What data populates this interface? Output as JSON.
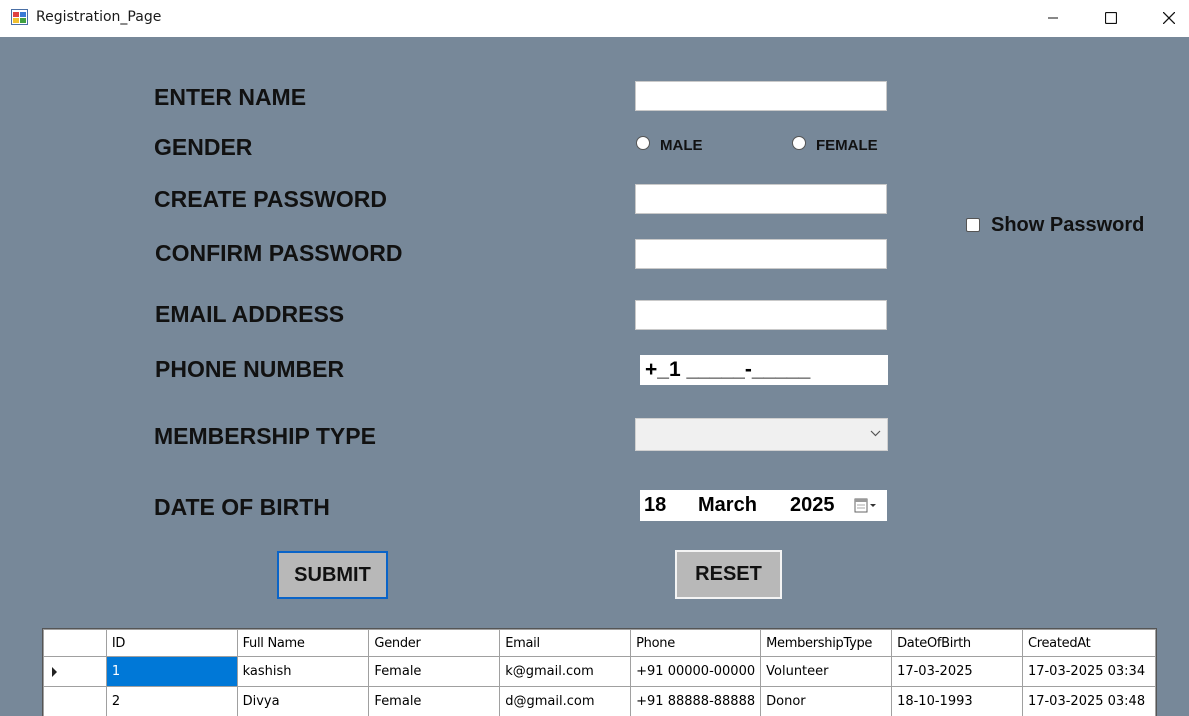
{
  "window": {
    "title": "Registration_Page"
  },
  "form": {
    "name_label": "ENTER NAME",
    "gender_label": "GENDER",
    "male_label": "MALE",
    "female_label": "FEMALE",
    "create_password_label": "CREATE PASSWORD",
    "confirm_password_label": "CONFIRM PASSWORD",
    "show_password_label": "Show Password",
    "email_label": "EMAIL ADDRESS",
    "phone_label": "PHONE NUMBER",
    "phone_value": "+_1 _____-_____",
    "membership_label": "MEMBERSHIP TYPE",
    "membership_value": "",
    "dob_label": "DATE OF BIRTH",
    "dob": {
      "day": "18",
      "month": "March",
      "year": "2025"
    },
    "submit_label": "SUBMIT",
    "reset_label": "RESET"
  },
  "grid": {
    "columns": [
      "ID",
      "Full Name",
      "Gender",
      "Email",
      "Phone",
      "MembershipType",
      "DateOfBirth",
      "CreatedAt"
    ],
    "rows": [
      [
        "1",
        "kashish",
        "Female",
        "k@gmail.com",
        "+91 00000-00000",
        "Volunteer",
        "17-03-2025",
        "17-03-2025 03:34"
      ],
      [
        "2",
        "Divya",
        "Female",
        "d@gmail.com",
        "+91 88888-88888",
        "Donor",
        "18-10-1993",
        "17-03-2025 03:48"
      ]
    ]
  },
  "colors": {
    "client_bg": "#778899",
    "selection": "#0078d7",
    "button_bg": "#b8b8b8"
  }
}
